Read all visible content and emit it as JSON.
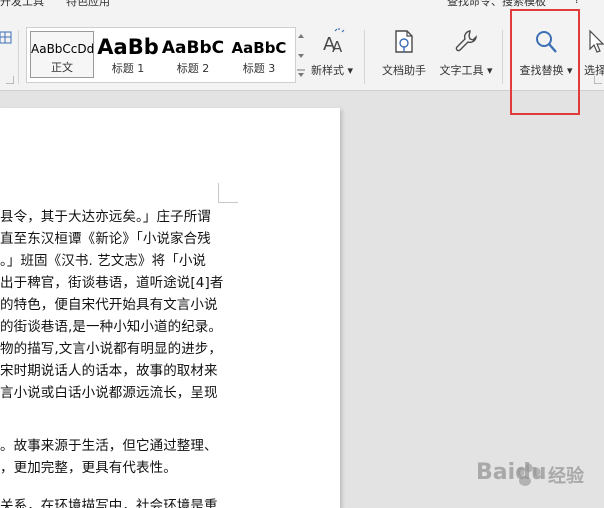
{
  "topbar": {
    "items": [
      "开发工具",
      "特色应用",
      "查找命令、搜索模板",
      "?"
    ]
  },
  "styles": {
    "items": [
      {
        "sample": "AaBbCcDd",
        "label": "正文"
      },
      {
        "sample": "AaBb",
        "label": "标题 1"
      },
      {
        "sample": "AaBbC",
        "label": "标题 2"
      },
      {
        "sample": "AaBbC",
        "label": "标题 3"
      }
    ],
    "selected_index": 0
  },
  "toolbar": {
    "new_style": "新样式",
    "doc_assistant": "文档助手",
    "text_tools": "文字工具",
    "find_replace": "查找替换",
    "select": "选择"
  },
  "document": {
    "lines": [
      "县令，其于大达亦远矣。」庄子所谓",
      "直至东汉桓谭《新论》「小说家合残",
      "。」班固《汉书. 艺文志》将「小说",
      "出于稗官，街谈巷语，道听途说[4]者",
      "的特色，便自宋代开始具有文言小说",
      "的街谈巷语,是一种小知小道的纪录。",
      "物的描写,文言小说都有明显的进步，",
      "宋时期说话人的话本，故事的取材来",
      "言小说或白话小说都源远流长，呈现",
      "",
      "。故事来源于生活，但它通过整理、",
      "，更加完整，更具有代表性。",
      "",
      "关系，在环境描写中，社会环境是重"
    ]
  },
  "watermark": {
    "brand": "Baidu",
    "suffix": "经验"
  }
}
